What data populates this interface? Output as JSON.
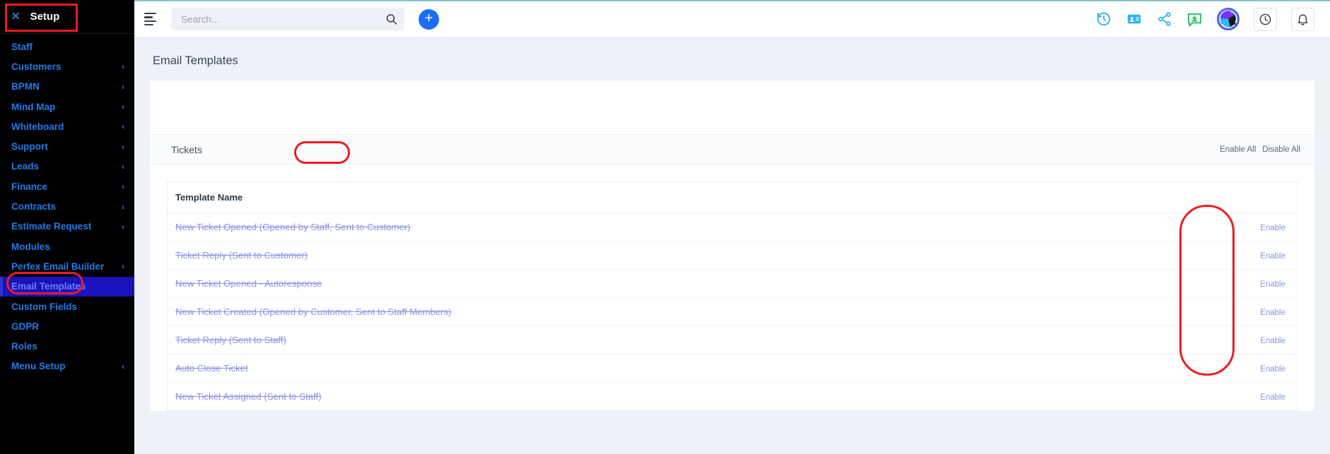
{
  "sidebar": {
    "header": {
      "close_icon": "close-icon",
      "title": "Setup"
    },
    "items": [
      {
        "label": "Staff",
        "chevron": ""
      },
      {
        "label": "Customers",
        "chevron": "‹"
      },
      {
        "label": "BPMN",
        "chevron": "‹"
      },
      {
        "label": "Mind Map",
        "chevron": "‹"
      },
      {
        "label": "Whiteboard",
        "chevron": "‹"
      },
      {
        "label": "Support",
        "chevron": "‹"
      },
      {
        "label": "Leads",
        "chevron": "‹"
      },
      {
        "label": "Finance",
        "chevron": "‹"
      },
      {
        "label": "Contracts",
        "chevron": "‹"
      },
      {
        "label": "Estimate Request",
        "chevron": "‹"
      },
      {
        "label": "Modules",
        "chevron": ""
      },
      {
        "label": "Perfex Email Builder",
        "chevron": "‹"
      },
      {
        "label": "Email Templates",
        "chevron": "",
        "active": true
      },
      {
        "label": "Custom Fields",
        "chevron": ""
      },
      {
        "label": "GDPR",
        "chevron": ""
      },
      {
        "label": "Roles",
        "chevron": ""
      },
      {
        "label": "Menu Setup",
        "chevron": "‹"
      }
    ]
  },
  "topbar": {
    "menu_toggle_icon": "hamburger-icon",
    "search": {
      "placeholder": "Search...",
      "value": "",
      "icon": "search-icon"
    },
    "add_button": {
      "label": "+",
      "icon": "plus-icon"
    },
    "icons": [
      "history-clock-icon",
      "contact-card-icon",
      "share-icon",
      "chat-message-icon",
      "user-avatar-pinwheel",
      "clock-icon",
      "bell-notification-icon"
    ]
  },
  "content": {
    "page_title": "Email Templates",
    "tabs": [
      {
        "label": "Tickets",
        "active": true
      }
    ],
    "bulk_actions": [
      {
        "label": "Enable All"
      },
      {
        "label": "Disable All"
      }
    ],
    "table": {
      "columns": [
        "Template Name",
        ""
      ],
      "rows": [
        {
          "name": "New Ticket Opened (Opened by Staff, Sent to Customer)",
          "action": "Enable",
          "disabled": true
        },
        {
          "name": "Ticket Reply (Sent to Customer)",
          "action": "Enable",
          "disabled": true
        },
        {
          "name": "New Ticket Opened - Autoresponse",
          "action": "Enable",
          "disabled": true
        },
        {
          "name": "New Ticket Created (Opened by Customer, Sent to Staff Members)",
          "action": "Enable",
          "disabled": true
        },
        {
          "name": "Ticket Reply (Sent to Staff)",
          "action": "Enable",
          "disabled": true
        },
        {
          "name": "Auto Close Ticket",
          "action": "Enable",
          "disabled": true
        },
        {
          "name": "New Ticket Assigned (Sent to Staff)",
          "action": "Enable",
          "disabled": true
        }
      ]
    }
  },
  "annotations": {
    "highlight_color": "#ef1b21",
    "regions": [
      "setup-header",
      "email-templates-nav",
      "tickets-tab",
      "enable-links-column"
    ]
  }
}
